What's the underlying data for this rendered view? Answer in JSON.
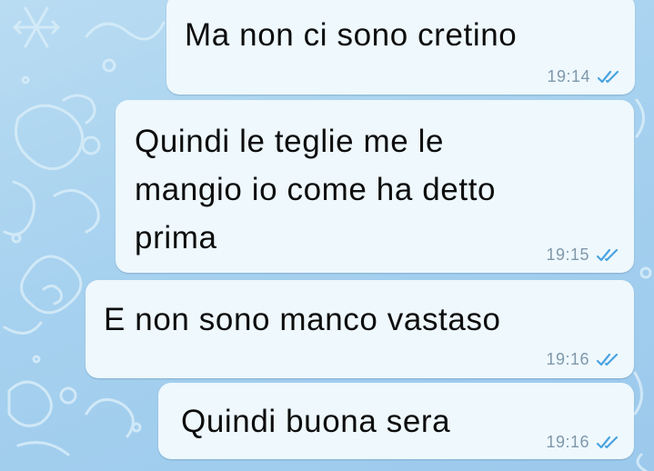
{
  "messages": [
    {
      "text": "Ma non ci sono cretino",
      "time": "19:14",
      "status": "read"
    },
    {
      "lines": [
        "Quindi le teglie me le",
        "mangio io come ha detto",
        "prima"
      ],
      "time": "19:15",
      "status": "read"
    },
    {
      "text": "E non sono manco vastaso",
      "time": "19:16",
      "status": "read"
    },
    {
      "text": "Quindi buona sera",
      "time": "19:16",
      "status": "read"
    }
  ],
  "icons": {
    "read_receipt": "double-check-icon",
    "wallpaper": "doodle-pattern"
  },
  "colors": {
    "bubble": "#eef8fd",
    "text": "#0d0d0d",
    "time": "#7f98ab",
    "check": "#4aa3e0",
    "wallpaper_bg": "#a6d1ef",
    "wallpaper_doodle": "#d6ecf9"
  }
}
